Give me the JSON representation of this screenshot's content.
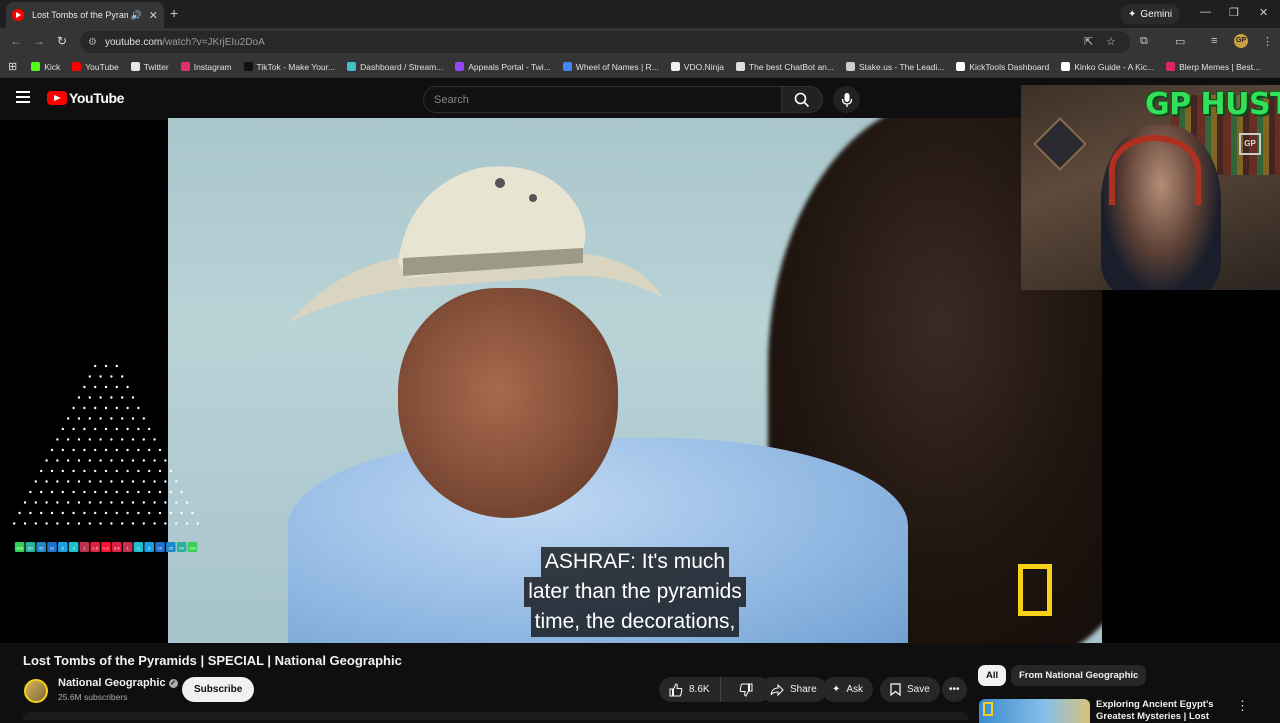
{
  "browser": {
    "tab_title": "Lost Tombs of the Pyramids",
    "gemini_label": "Gemini",
    "url_host": "youtube.com",
    "url_path": "/watch?v=JKrjEIu2DoA",
    "profile_initials": "GP",
    "bookmarks": [
      {
        "label": "Kick",
        "color": "#53fc18"
      },
      {
        "label": "YouTube",
        "color": "#ff0000"
      },
      {
        "label": "Twitter",
        "color": "#e7e7e7"
      },
      {
        "label": "Instagram",
        "color": "#e1306c"
      },
      {
        "label": "TikTok - Make Your...",
        "color": "#111111"
      },
      {
        "label": "Dashboard / Stream...",
        "color": "#3fc1c9"
      },
      {
        "label": "Appeals Portal - Twi...",
        "color": "#9146ff"
      },
      {
        "label": "Wheel of Names | R...",
        "color": "#4285f4"
      },
      {
        "label": "VDO.Ninja",
        "color": "#eeeeee"
      },
      {
        "label": "The best ChatBot an...",
        "color": "#dddddd"
      },
      {
        "label": "Stake.us - The Leadi...",
        "color": "#cccccc"
      },
      {
        "label": "KickTools Dashboard",
        "color": "#ffffff"
      },
      {
        "label": "Kinko Guide - A Kic...",
        "color": "#ffffff"
      },
      {
        "label": "Blerp Memes | Best...",
        "color": "#e0245e"
      }
    ]
  },
  "youtube": {
    "logo_text": "YouTube",
    "search_placeholder": "Search"
  },
  "video": {
    "captions": [
      "ASHRAF: It's much",
      "later than the pyramids",
      "time, the decorations,"
    ],
    "title": "Lost Tombs of the Pyramids | SPECIAL | National Geographic",
    "channel_name": "National Geographic",
    "subscribers": "25.6M subscribers",
    "subscribe_label": "Subscribe",
    "likes": "8.6K",
    "share_label": "Share",
    "ask_label": "Ask",
    "save_label": "Save"
  },
  "overlay": {
    "stream_brand": "GP HUSTLA",
    "stream_badge": "GP",
    "plinko_slots": [
      "100",
      "50",
      "25",
      "10",
      "5",
      "3",
      "1",
      "0.5",
      "0.2",
      "0.5",
      "1",
      "3",
      "5",
      "10",
      "25",
      "50",
      "100"
    ]
  },
  "sidebar": {
    "chips": [
      "All",
      "From National Geographic"
    ],
    "rec_title": "Exploring Ancient Egypt's Greatest Mysteries | Lost"
  },
  "colors": {
    "natgeo_yellow": "#f7d117",
    "youtube_red": "#ff0000",
    "brand_green": "#33e05a"
  }
}
